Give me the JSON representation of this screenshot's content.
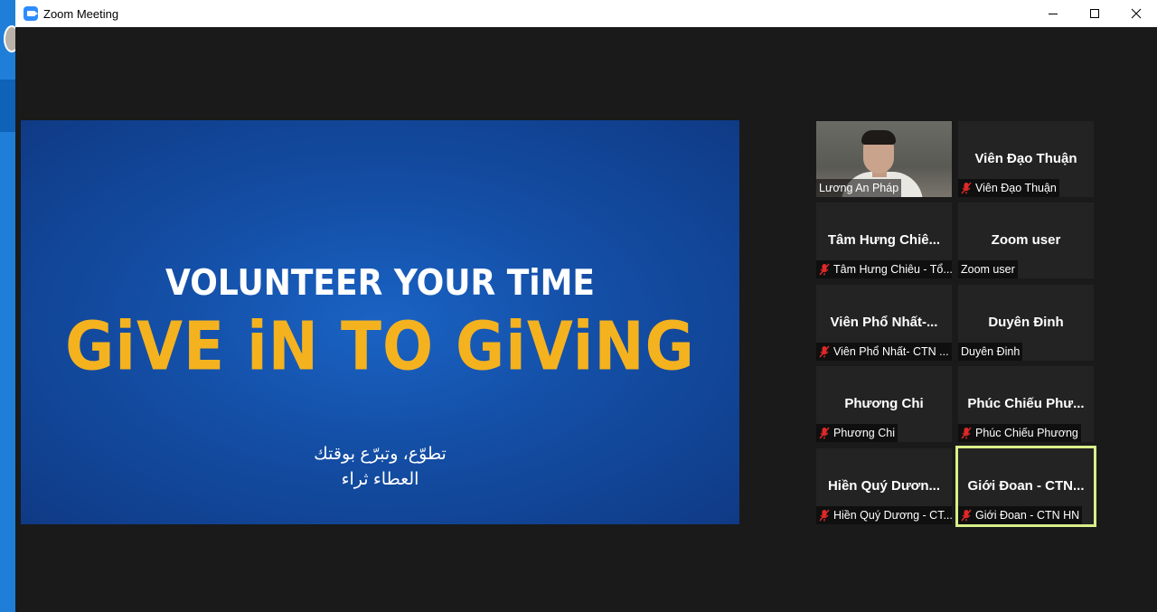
{
  "window": {
    "title": "Zoom Meeting",
    "controls": [
      "minimize",
      "maximize",
      "close"
    ]
  },
  "share_screen": {
    "line1": "VOLUNTEER YOUR TiME",
    "line2": "GiVE iN TO GiViNG",
    "arabic_line1": "تطوّع، وتبرّع بوقتك",
    "arabic_line2": "العطاء ثراء",
    "colors": {
      "background": "#1450a8",
      "accent": "#f5b21f"
    }
  },
  "participants": [
    {
      "display_name": "",
      "label": "Lương An Pháp",
      "muted": false,
      "video": true
    },
    {
      "display_name": "Viên Đạo Thuận",
      "label": "Viên Đạo Thuận",
      "muted": true
    },
    {
      "display_name": "Tâm Hưng Chiê...",
      "label": "Tâm Hưng Chiêu - Tổ...",
      "muted": true
    },
    {
      "display_name": "Zoom user",
      "label": "Zoom user",
      "muted": false
    },
    {
      "display_name": "Viên Phổ Nhất-...",
      "label": "Viên Phổ Nhất- CTN ...",
      "muted": true
    },
    {
      "display_name": "Duyên Đinh",
      "label": "Duyên Đinh",
      "muted": false
    },
    {
      "display_name": "Phương Chi",
      "label": "Phương Chi",
      "muted": true
    },
    {
      "display_name": "Phúc Chiếu Phư...",
      "label": "Phúc Chiếu Phương",
      "muted": true
    },
    {
      "display_name": "Hiền Quý Dươn...",
      "label": "Hiền Quý Dương - CT...",
      "muted": true
    },
    {
      "display_name": "Giới Đoan - CTN...",
      "label": "Giới Đoan - CTN HN",
      "muted": true,
      "active_speaker": true
    }
  ],
  "colors": {
    "active_speaker_border": "#d8ef8a",
    "muted_icon": "#e02828",
    "zoom_blue": "#2d8cff"
  }
}
